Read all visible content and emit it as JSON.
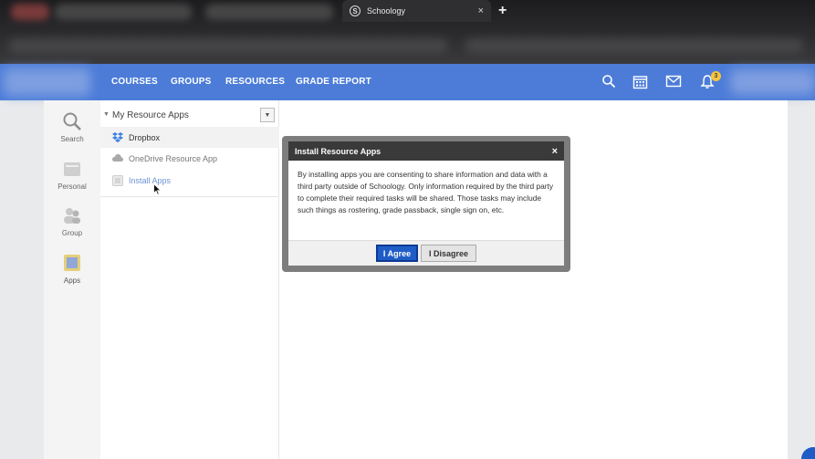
{
  "browser": {
    "tab_title": "Schoology",
    "tab_close": "×",
    "new_tab": "+",
    "favicon": "S"
  },
  "navbar": {
    "items": [
      "COURSES",
      "GROUPS",
      "RESOURCES",
      "GRADE REPORT"
    ],
    "notification_count": "3",
    "icons": [
      "search-icon",
      "calendar-icon",
      "mail-icon",
      "bell-icon"
    ],
    "color": "#4c7cd8"
  },
  "left_rail": {
    "items": [
      {
        "label": "Search",
        "icon": "search-icon"
      },
      {
        "label": "Personal",
        "icon": "personal-icon"
      },
      {
        "label": "Group",
        "icon": "group-icon"
      },
      {
        "label": "Apps",
        "icon": "apps-icon"
      }
    ]
  },
  "resources": {
    "header": "My Resource Apps",
    "items": [
      {
        "label": "Dropbox",
        "icon": "dropbox-icon"
      },
      {
        "label": "OneDrive Resource App",
        "icon": "cloud-icon"
      },
      {
        "label": "Install Apps",
        "icon": "install-apps-icon"
      }
    ]
  },
  "modal": {
    "title": "Install Resource Apps",
    "close": "×",
    "body": "By installing apps you are consenting to share information and data with a third party outside of Schoology. Only information required by the third party to complete their required tasks will be shared. Those tasks may include such things as rostering, grade passback, single sign on, etc.",
    "agree_label": "I Agree",
    "disagree_label": "I Disagree",
    "agree_color": "#1f5cc6"
  }
}
